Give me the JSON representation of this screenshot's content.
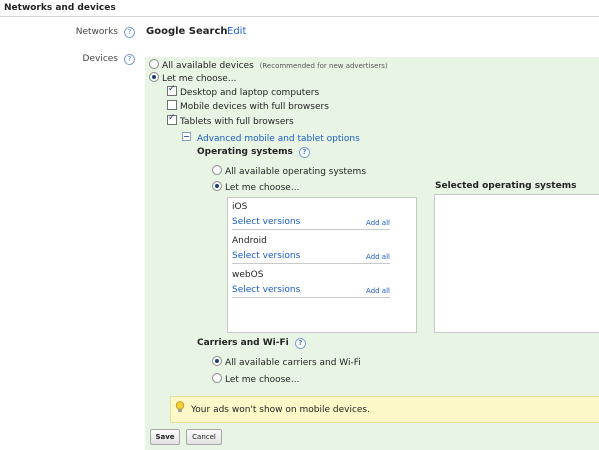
{
  "section": {
    "title": "Networks and devices"
  },
  "networks": {
    "label": "Networks",
    "value": "Google Search",
    "edit_link": "Edit"
  },
  "devices": {
    "label": "Devices",
    "options": [
      {
        "label": "All available devices",
        "note": "(Recommended for new advertisers)",
        "selected": false
      },
      {
        "label": "Let me choose...",
        "selected": true
      }
    ],
    "checkboxes": [
      {
        "label": "Desktop and laptop computers",
        "checked": true
      },
      {
        "label": "Mobile devices with full browsers",
        "checked": false
      },
      {
        "label": "Tablets with full browsers",
        "checked": true
      }
    ],
    "advanced_link": "Advanced mobile and tablet options"
  },
  "operating_systems": {
    "heading": "Operating systems",
    "options": [
      {
        "label": "All available operating systems",
        "selected": false
      },
      {
        "label": "Let me choose...",
        "selected": true
      }
    ],
    "list": [
      {
        "name": "iOS",
        "versions_link": "Select versions",
        "add_all": "Add all"
      },
      {
        "name": "Android",
        "versions_link": "Select versions",
        "add_all": "Add all"
      },
      {
        "name": "webOS",
        "versions_link": "Select versions",
        "add_all": "Add all"
      }
    ],
    "selected_heading": "Selected operating systems"
  },
  "carriers": {
    "heading": "Carriers and Wi-Fi",
    "options": [
      {
        "label": "All available carriers and Wi-Fi",
        "selected": true
      },
      {
        "label": "Let me choose...",
        "selected": false
      }
    ]
  },
  "warning": {
    "text": "Your ads won't show on mobile devices."
  },
  "buttons": {
    "save": "Save",
    "cancel": "Cancel"
  },
  "icons": {
    "help": "help-icon",
    "bulb": "lightbulb-icon",
    "collapse": "collapse-icon"
  },
  "colors": {
    "panel": "#e8f5e5",
    "link": "#1a5cc8",
    "warning_bg": "#fdf8c8"
  }
}
